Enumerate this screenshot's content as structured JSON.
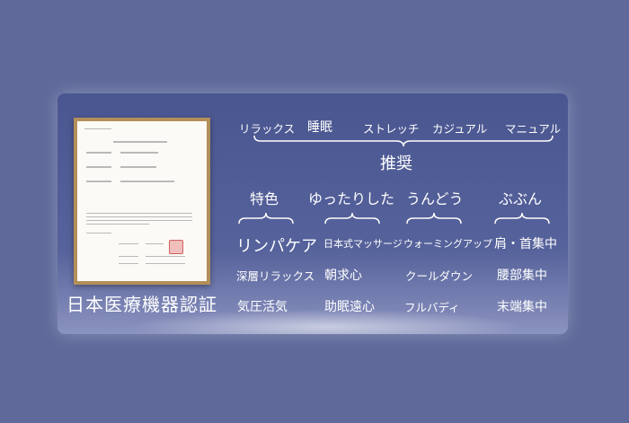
{
  "certificate": {
    "title": "日本医療機器認証"
  },
  "recommend": {
    "items": [
      "リラックス",
      "睡眠",
      "ストレッチ",
      "カジュアル",
      "マニュアル"
    ],
    "label": "推奨"
  },
  "features": {
    "headers": [
      "特色",
      "ゆったりした",
      "うんどう",
      "ぶぶん"
    ],
    "rows": [
      [
        "リンパケア",
        "日本式マッサージ",
        "ウォーミングアップ",
        "肩・首集中"
      ],
      [
        "深層リラックス",
        "朝求心",
        "クールダウン",
        "腰部集中"
      ],
      [
        "気圧活気",
        "助眠遠心",
        "フルバディ",
        "末端集中"
      ]
    ]
  }
}
